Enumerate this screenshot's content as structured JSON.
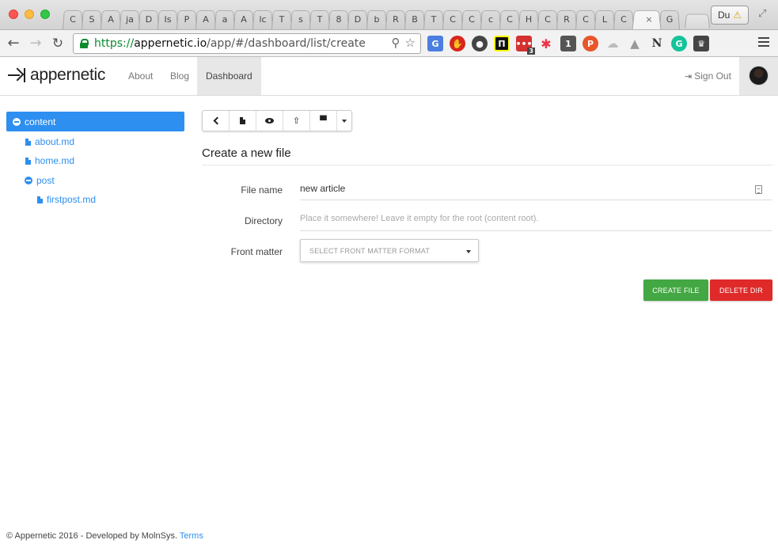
{
  "browser": {
    "tabs": [
      "C",
      "S",
      "A",
      "ja",
      "D",
      "Is",
      "P",
      "A",
      "a",
      "A",
      "lc",
      "T",
      "s",
      "T",
      "8",
      "D",
      "b",
      "R",
      "B",
      "T",
      "C",
      "C",
      "c",
      "C",
      "H",
      "C",
      "R",
      "C",
      "L",
      "C",
      "",
      "G"
    ],
    "active_tab_close": "×",
    "profile_label": "Du",
    "url_scheme": "https://",
    "url_host": "appernetic.io",
    "url_path": "/app/#/dashboard/list/create",
    "extension_badge": "3",
    "extension_one_label": "1",
    "extension_p_label": "P",
    "extension_n_label": "N",
    "extension_g_label": "G"
  },
  "navbar": {
    "brand": "appernetic",
    "links": [
      "About",
      "Blog",
      "Dashboard"
    ],
    "active_link": "Dashboard",
    "signout": "Sign Out"
  },
  "sidebar": {
    "root": "content",
    "items": [
      {
        "label": "about.md",
        "type": "file",
        "depth": 1
      },
      {
        "label": "home.md",
        "type": "file",
        "depth": 1
      },
      {
        "label": "post",
        "type": "folder",
        "depth": 1
      },
      {
        "label": "firstpost.md",
        "type": "file",
        "depth": 2
      }
    ]
  },
  "main": {
    "title": "Create a new file",
    "form": {
      "file_name_label": "File name",
      "file_name_value": "new article",
      "directory_label": "Directory",
      "directory_placeholder": "Place it somewhere! Leave it empty for the root (content root).",
      "front_matter_label": "Front matter",
      "front_matter_select": "SELECT FRONT MATTER FORMAT"
    },
    "buttons": {
      "create": "CREATE FILE",
      "delete": "DELETE DIR"
    }
  },
  "footer": {
    "text": "© Appernetic 2016 - Developed by MolnSys.",
    "link": "Terms"
  },
  "colors": {
    "accent": "#2d8ff0",
    "create": "#43a843",
    "delete": "#e02a2a"
  }
}
